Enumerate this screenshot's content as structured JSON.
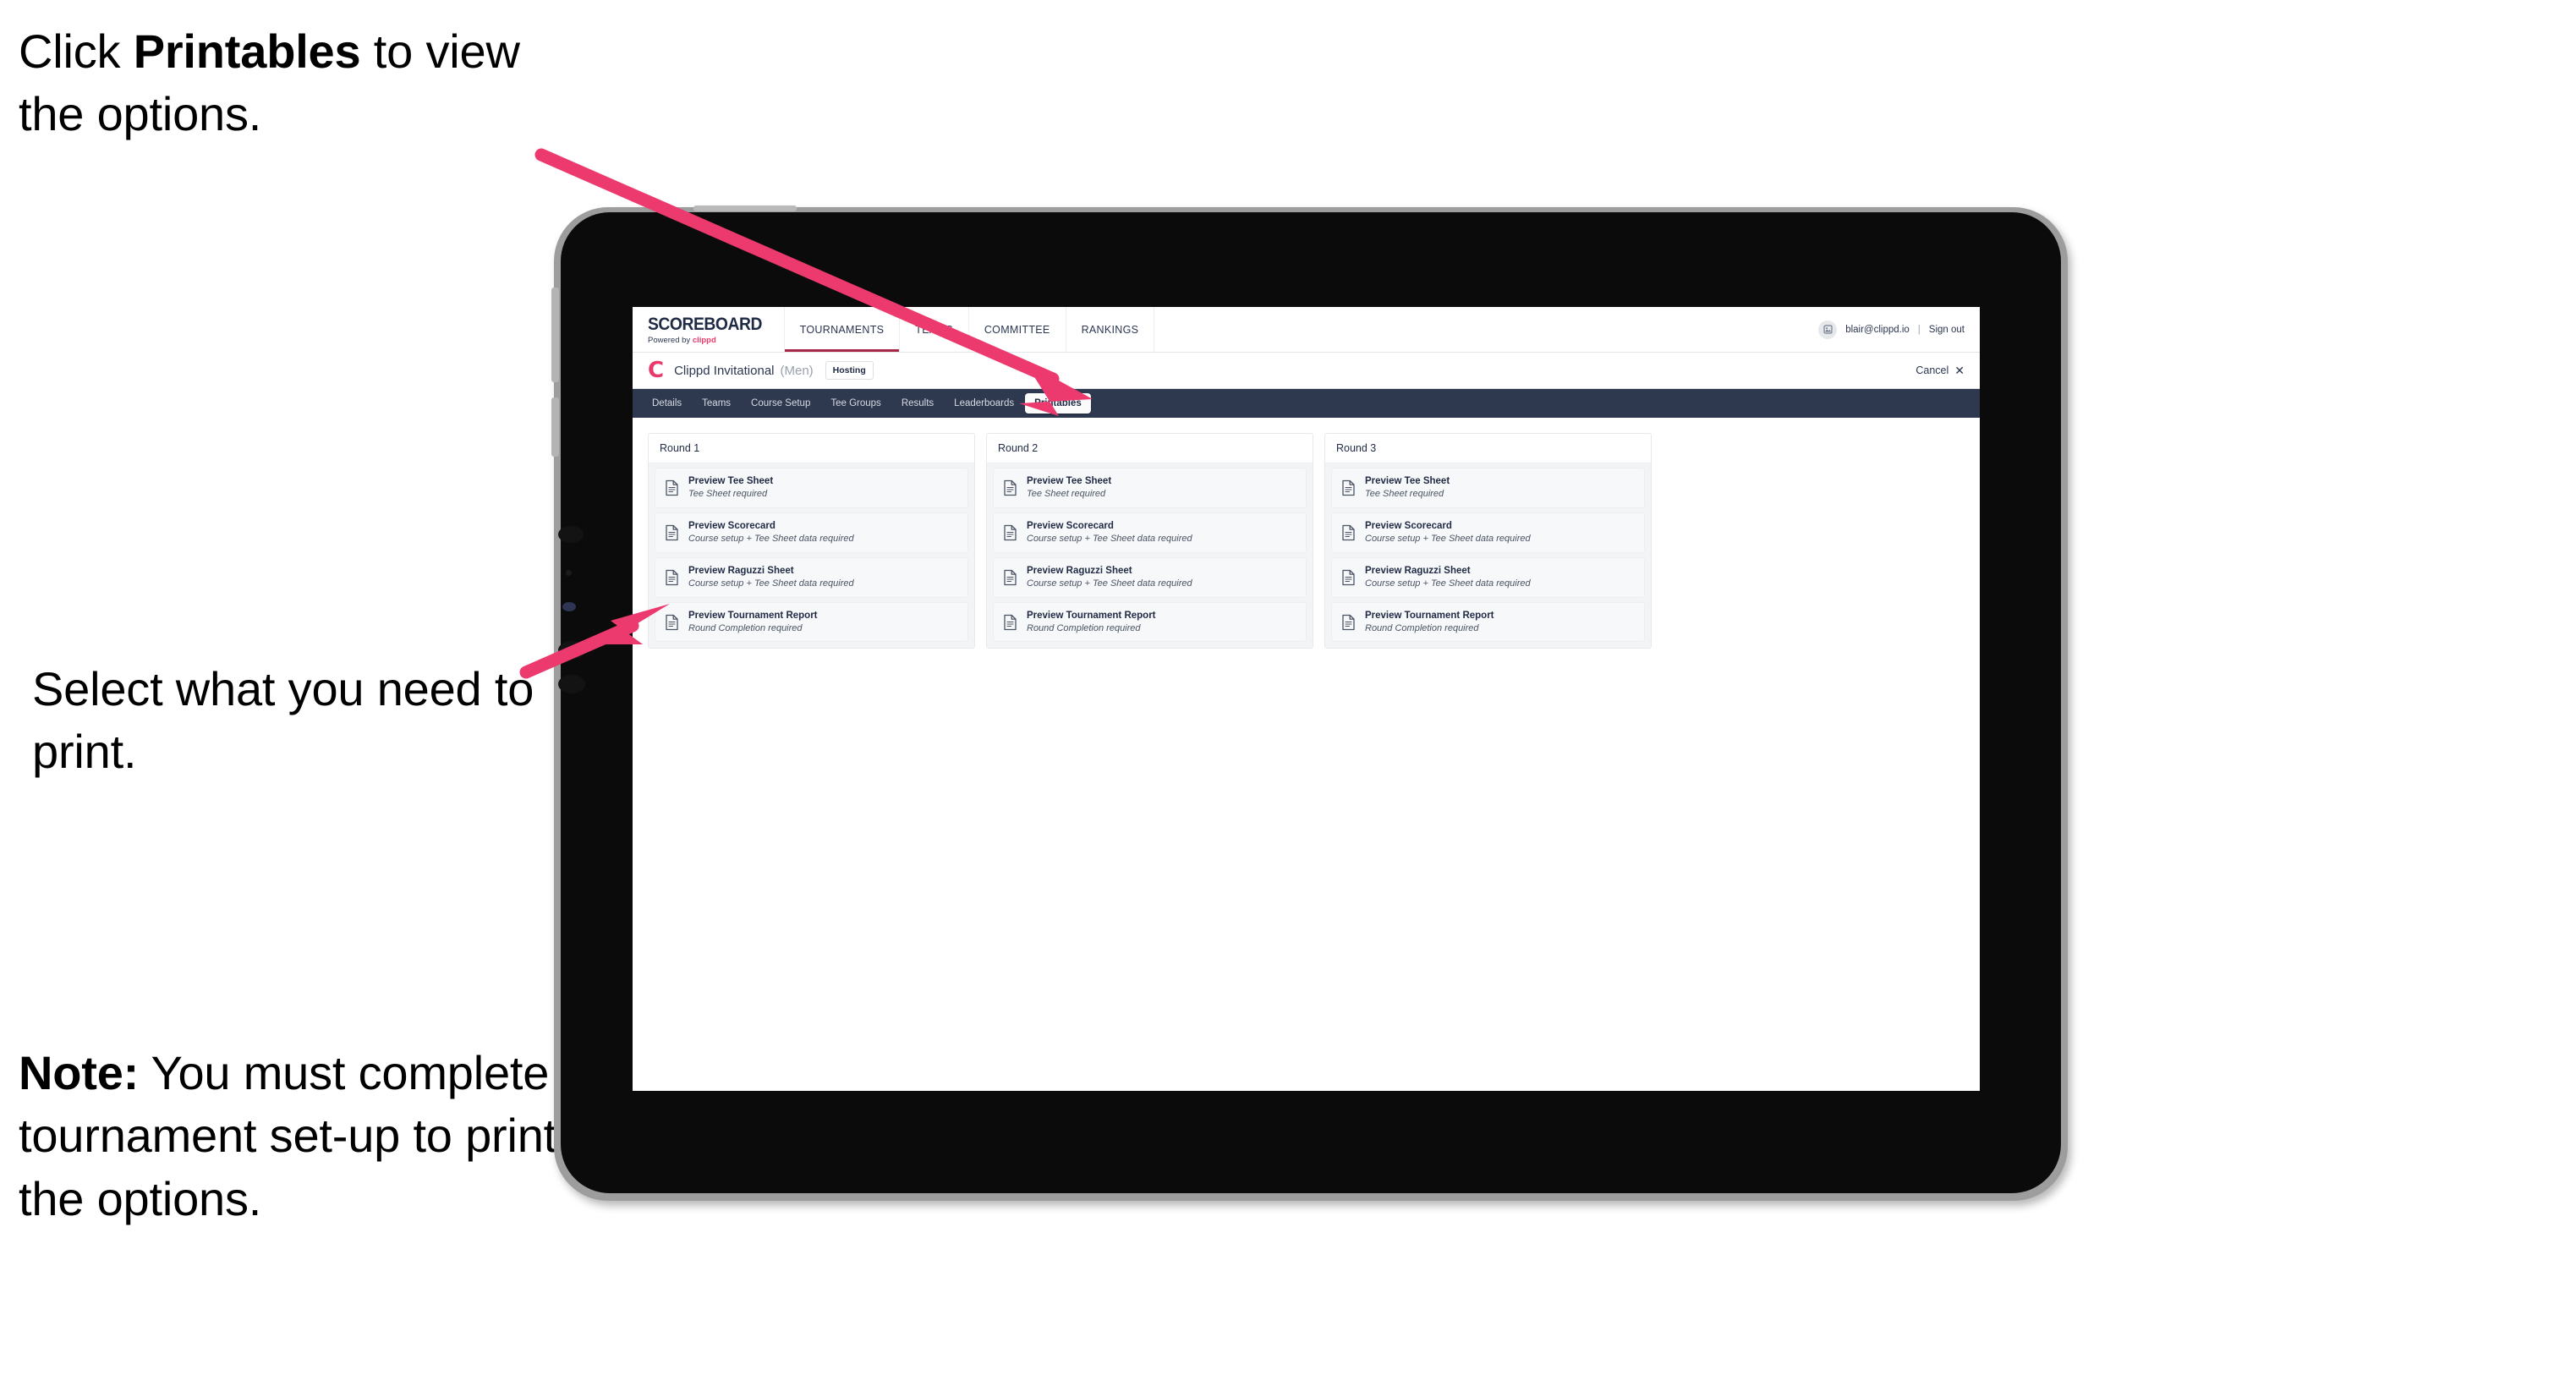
{
  "annotations": [
    {
      "id": "annot-1",
      "pre": "Click ",
      "bold": "Printables",
      "post": " to view the options."
    },
    {
      "id": "annot-2",
      "pre": "Select what you need to print.",
      "bold": "",
      "post": ""
    },
    {
      "id": "annot-3",
      "pre": "",
      "bold": "Note:",
      "post": " You must complete the tournament set-up to print all the options."
    }
  ],
  "colors": {
    "arrow_pink": "#ed3a6e",
    "brand_pink": "#e8396a",
    "tabbar_dark": "#2e3950",
    "accent_underline": "#a8284a"
  },
  "app": {
    "brand": {
      "title": "SCOREBOARD",
      "sub_prefix": "Powered by ",
      "sub_brand": "clippd"
    },
    "topnav": [
      {
        "label": "TOURNAMENTS",
        "active": true
      },
      {
        "label": "TEAMS",
        "active": false
      },
      {
        "label": "COMMITTEE",
        "active": false
      },
      {
        "label": "RANKINGS",
        "active": false
      }
    ],
    "account": {
      "avatar_icon": "user-avatar-icon",
      "email": "blair@clippd.io",
      "separator": "|",
      "sign_out": "Sign out"
    },
    "tournament_bar": {
      "logo_letter": "C",
      "name": "Clippd Invitational",
      "gender": "(Men)",
      "hosting_badge": "Hosting",
      "cancel_label": "Cancel",
      "cancel_icon": "close-icon"
    },
    "tabs": [
      {
        "label": "Details",
        "active": false
      },
      {
        "label": "Teams",
        "active": false
      },
      {
        "label": "Course Setup",
        "active": false
      },
      {
        "label": "Tee Groups",
        "active": false
      },
      {
        "label": "Results",
        "active": false
      },
      {
        "label": "Leaderboards",
        "active": false
      },
      {
        "label": "Printables",
        "active": true
      }
    ],
    "rounds": [
      {
        "title": "Round 1",
        "items": [
          {
            "title": "Preview Tee Sheet",
            "sub": "Tee Sheet required"
          },
          {
            "title": "Preview Scorecard",
            "sub": "Course setup + Tee Sheet data required"
          },
          {
            "title": "Preview Raguzzi Sheet",
            "sub": "Course setup + Tee Sheet data required"
          },
          {
            "title": "Preview Tournament Report",
            "sub": "Round Completion required"
          }
        ]
      },
      {
        "title": "Round 2",
        "items": [
          {
            "title": "Preview Tee Sheet",
            "sub": "Tee Sheet required"
          },
          {
            "title": "Preview Scorecard",
            "sub": "Course setup + Tee Sheet data required"
          },
          {
            "title": "Preview Raguzzi Sheet",
            "sub": "Course setup + Tee Sheet data required"
          },
          {
            "title": "Preview Tournament Report",
            "sub": "Round Completion required"
          }
        ]
      },
      {
        "title": "Round 3",
        "items": [
          {
            "title": "Preview Tee Sheet",
            "sub": "Tee Sheet required"
          },
          {
            "title": "Preview Scorecard",
            "sub": "Course setup + Tee Sheet data required"
          },
          {
            "title": "Preview Raguzzi Sheet",
            "sub": "Course setup + Tee Sheet data required"
          },
          {
            "title": "Preview Tournament Report",
            "sub": "Round Completion required"
          }
        ]
      }
    ]
  }
}
